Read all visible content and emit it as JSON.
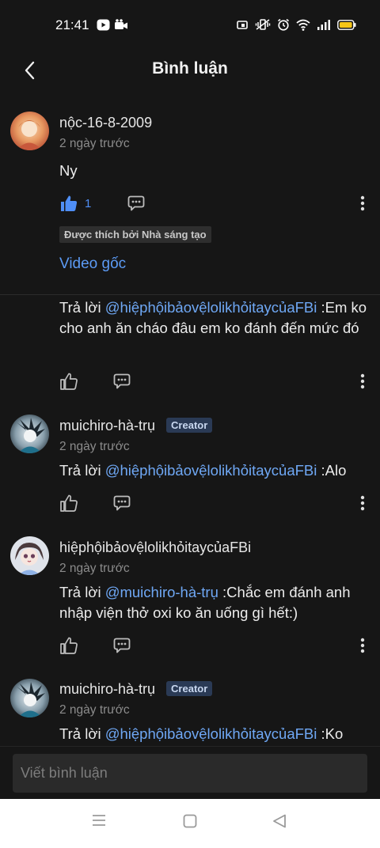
{
  "status": {
    "time": "21:41",
    "battery_color": "#f5c518"
  },
  "header": {
    "title": "Bình luận"
  },
  "comments": [
    {
      "username": "nộc-16-8-2009",
      "time": "2 ngày trước",
      "text": "Ny",
      "likes": "1",
      "liked_by_creator": "Được thích bởi Nhà sáng tạo",
      "video_link": "Video gốc"
    },
    {
      "prefix": "Trả lời ",
      "mention": "@hiệphộibảovệlolikhỏitaycủaFBi",
      "text": " :Em ko cho anh ăn cháo đâu em ko đánh đến mức đó"
    },
    {
      "username": "muichiro-hà-trụ",
      "badge": "Creator",
      "time": "2 ngày trước",
      "prefix": "Trả lời ",
      "mention": "@hiệphộibảovệlolikhỏitaycủaFBi",
      "text": " :Alo"
    },
    {
      "username": "hiệphộibảovệlolikhỏitaycủaFBi",
      "time": "2 ngày trước",
      "prefix": "Trả lời ",
      "mention": "@muichiro-hà-trụ",
      "text": " :Chắc em đánh anh nhập viện thở oxi ko ăn uống gì hết:)"
    },
    {
      "username": "muichiro-hà-trụ",
      "badge": "Creator",
      "time": "2 ngày trước",
      "prefix": "Trả lời ",
      "mention": "@hiệphộibảovệlolikhỏitaycủaFBi",
      "text": " :Ko"
    }
  ],
  "composer": {
    "placeholder": "Viết bình luận"
  },
  "colors": {
    "background": "#161616",
    "accent": "#5c9bf5",
    "like_active": "#4f8ff7",
    "creator_badge": "#2a3a55"
  }
}
